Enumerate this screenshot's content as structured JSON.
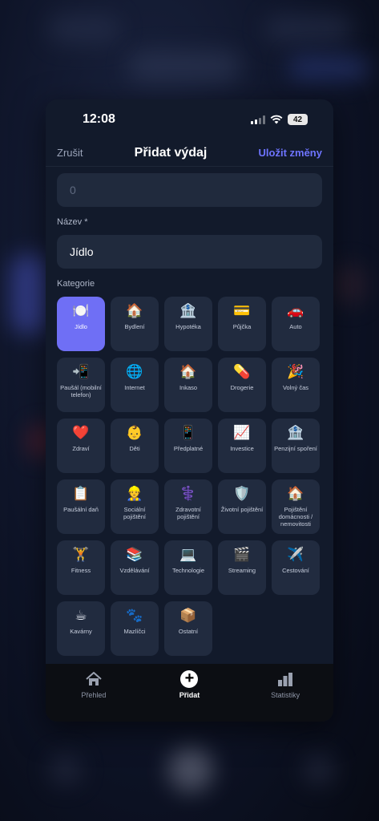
{
  "status_bar": {
    "time": "12:08",
    "battery": "42"
  },
  "nav": {
    "cancel": "Zrušit",
    "title": "Přidat výdaj",
    "save": "Uložit změny"
  },
  "form": {
    "amount_placeholder": "0",
    "name_label": "Název *",
    "name_value": "Jídlo",
    "category_label": "Kategorie"
  },
  "categories": [
    {
      "emoji": "🍽️",
      "label": "Jídlo",
      "selected": true
    },
    {
      "emoji": "🏠",
      "label": "Bydlení"
    },
    {
      "emoji": "🏦",
      "label": "Hypotéka"
    },
    {
      "emoji": "💳",
      "label": "Půjčka"
    },
    {
      "emoji": "🚗",
      "label": "Auto"
    },
    {
      "emoji": "📲",
      "label": "Paušál (mobilní telefon)"
    },
    {
      "emoji": "🌐",
      "label": "Internet"
    },
    {
      "emoji": "🏠",
      "label": "Inkaso"
    },
    {
      "emoji": "💊",
      "label": "Drogerie"
    },
    {
      "emoji": "🎉",
      "label": "Volný čas"
    },
    {
      "emoji": "❤️",
      "label": "Zdraví"
    },
    {
      "emoji": "👶",
      "label": "Děti"
    },
    {
      "emoji": "📱",
      "label": "Předplatné"
    },
    {
      "emoji": "📈",
      "label": "Investice"
    },
    {
      "emoji": "🏦",
      "label": "Penzijní spoření"
    },
    {
      "emoji": "📋",
      "label": "Paušální daň"
    },
    {
      "emoji": "👷",
      "label": "Sociální pojištění"
    },
    {
      "emoji": "⚕️",
      "label": "Zdravotní pojištění"
    },
    {
      "emoji": "🛡️",
      "label": "Životní pojištění"
    },
    {
      "emoji": "🏠",
      "label": "Pojištění domácnosti / nemovitosti"
    },
    {
      "emoji": "🏋️",
      "label": "Fitness"
    },
    {
      "emoji": "📚",
      "label": "Vzdělávání"
    },
    {
      "emoji": "💻",
      "label": "Technologie"
    },
    {
      "emoji": "🎬",
      "label": "Streaming"
    },
    {
      "emoji": "✈️",
      "label": "Cestování"
    },
    {
      "emoji": "☕",
      "label": "Kavárny"
    },
    {
      "emoji": "🐾",
      "label": "Mazlíčci"
    },
    {
      "emoji": "📦",
      "label": "Ostatní"
    }
  ],
  "tabbar": {
    "items": [
      {
        "label": "Přehled",
        "icon": "house-icon"
      },
      {
        "label": "Přidat",
        "icon": "plus-circle-icon",
        "active": true
      },
      {
        "label": "Statistiky",
        "icon": "bar-chart-icon"
      }
    ]
  },
  "colors": {
    "accent": "#6f6ff5",
    "save": "#6e74ff",
    "card": "#121a2b",
    "tile": "#212b3f"
  }
}
